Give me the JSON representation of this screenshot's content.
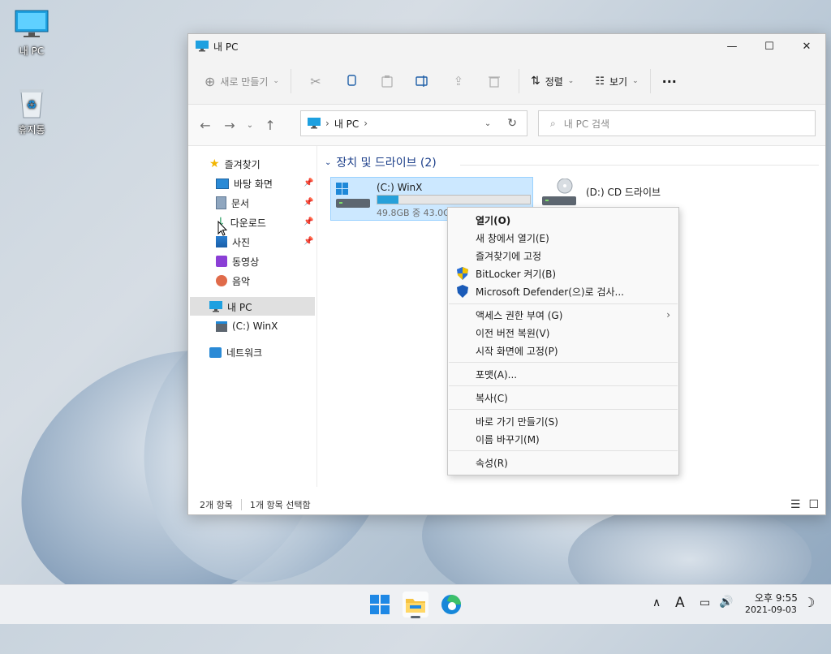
{
  "desktop": {
    "icons": [
      {
        "label": "내 PC"
      },
      {
        "label": "휴지통"
      }
    ]
  },
  "window": {
    "title": "내 PC",
    "controls": {
      "minimize": "—",
      "maximize": "☐",
      "close": "✕"
    }
  },
  "toolbar": {
    "new_label": "새로 만들기",
    "sort_label": "정렬",
    "view_label": "보기",
    "more_label": "···"
  },
  "address": {
    "path_root": "내 PC",
    "search_placeholder": "내 PC 검색"
  },
  "sidebar": {
    "favorites": "즐겨찾기",
    "items": [
      {
        "label": "바탕 화면"
      },
      {
        "label": "문서"
      },
      {
        "label": "다운로드"
      },
      {
        "label": "사진"
      },
      {
        "label": "동영상"
      },
      {
        "label": "음악"
      }
    ],
    "this_pc": "내 PC",
    "c_drive": "(C:) WinX",
    "network": "네트워크"
  },
  "content": {
    "group_title": "장치 및 드라이브 (2)",
    "drives": [
      {
        "name": "(C:) WinX",
        "free_text": "49.8GB 중 43.0GB 사용 가능",
        "used_fraction": 0.14
      },
      {
        "name": "(D:) CD 드라이브"
      }
    ]
  },
  "status": {
    "count": "2개 항목",
    "selected": "1개 항목 선택함"
  },
  "context_menu": {
    "groups": [
      [
        "열기(O)",
        "새 창에서 열기(E)",
        "즐겨찾기에 고정",
        "BitLocker 켜기(B)",
        "Microsoft Defender(으)로 검사..."
      ],
      [
        "액세스 권한 부여 (G)",
        "이전 버전 복원(V)",
        "시작 화면에 고정(P)"
      ],
      [
        "포맷(A)..."
      ],
      [
        "복사(C)"
      ],
      [
        "바로 가기 만들기(S)",
        "이름 바꾸기(M)"
      ],
      [
        "속성(R)"
      ]
    ]
  },
  "taskbar": {
    "time": "오후 9:55",
    "date": "2021-09-03",
    "ime": "A"
  },
  "colors": {
    "accent": "#26a0da",
    "selection": "#cce8ff",
    "group_title": "#1c3f8a"
  }
}
